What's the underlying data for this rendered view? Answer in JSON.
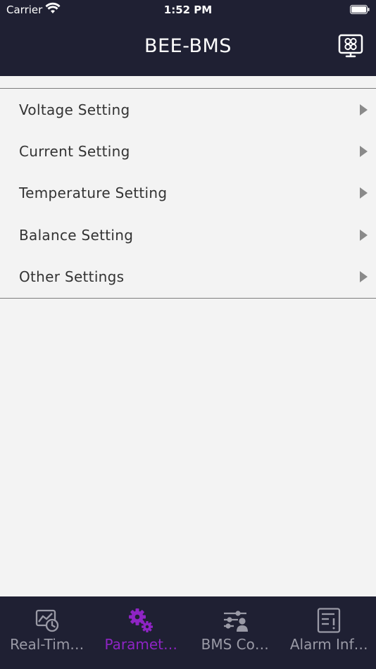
{
  "status_bar": {
    "carrier": "Carrier",
    "time": "1:52 PM"
  },
  "header": {
    "title": "BEE-BMS",
    "device_icon": "device-monitor-icon"
  },
  "menu": {
    "items": [
      {
        "label": "Voltage Setting"
      },
      {
        "label": "Current Setting"
      },
      {
        "label": "Temperature Setting"
      },
      {
        "label": "Balance Setting"
      },
      {
        "label": "Other Settings"
      }
    ]
  },
  "tabs": [
    {
      "label": "Real-Tim…",
      "icon": "realtime-chart-icon",
      "active": false
    },
    {
      "label": "Paramet…",
      "icon": "gears-icon",
      "active": true
    },
    {
      "label": "BMS Co…",
      "icon": "sliders-user-icon",
      "active": false
    },
    {
      "label": "Alarm Inf…",
      "icon": "alarm-doc-icon",
      "active": false
    }
  ],
  "colors": {
    "bar_bg": "#1f2033",
    "active_tab": "#8e24c4",
    "inactive_tab": "#9a9aa6",
    "page_bg": "#f3f3f3"
  }
}
